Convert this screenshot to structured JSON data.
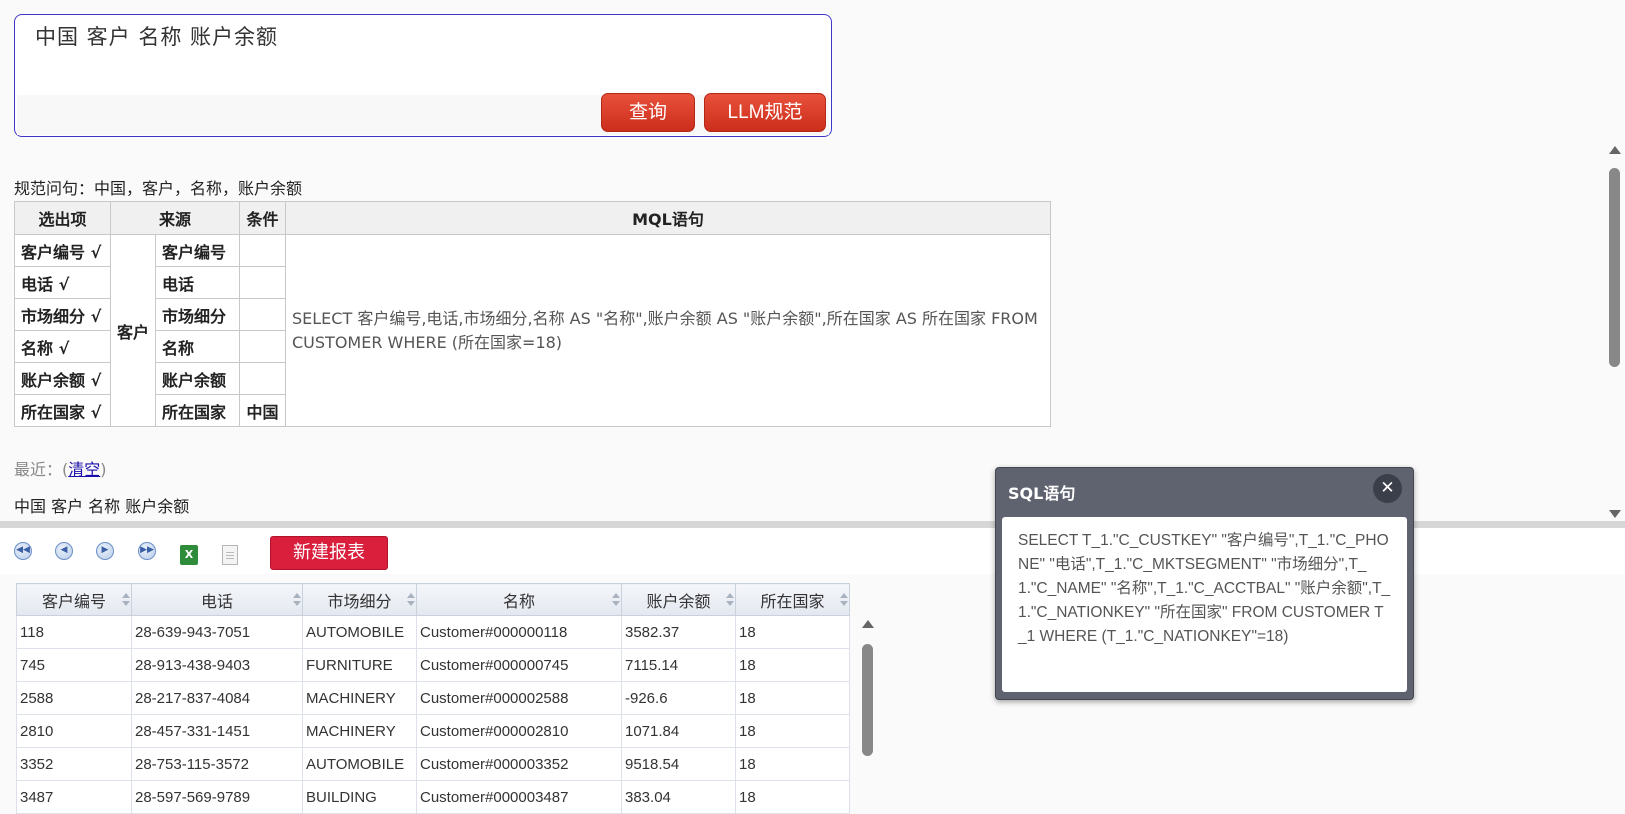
{
  "query": {
    "text": "中国  客户  名称  账户余额",
    "query_button": "查询",
    "llm_button": "LLM规范"
  },
  "normalized": {
    "label": "规范问句：",
    "text": "中国，客户，名称，账户余额"
  },
  "mql_table": {
    "headers": [
      "选出项",
      "来源",
      "条件",
      "MQL语句"
    ],
    "source_entity": "客户",
    "rows": [
      {
        "select": "客户编号 √",
        "field": "客户编号",
        "cond": ""
      },
      {
        "select": "电话 √",
        "field": "电话",
        "cond": ""
      },
      {
        "select": "市场细分 √",
        "field": "市场细分",
        "cond": ""
      },
      {
        "select": "名称 √",
        "field": "名称",
        "cond": ""
      },
      {
        "select": "账户余额 √",
        "field": "账户余额",
        "cond": ""
      },
      {
        "select": "所在国家 √",
        "field": "所在国家",
        "cond": "中国"
      }
    ],
    "mql": "SELECT 客户编号,电话,市场细分,名称 AS \"名称\",账户余额 AS \"账户余额\",所在国家 AS 所在国家 FROM CUSTOMER WHERE (所在国家=18)"
  },
  "recent": {
    "label": "最近：(",
    "clear_link": "清空",
    "close_paren": ")",
    "history_item": "中国 客户 名称 账户余额"
  },
  "toolbar": {
    "icons": [
      "first-page-icon",
      "prev-page-icon",
      "next-page-icon",
      "last-page-icon",
      "excel-export-icon",
      "document-icon"
    ],
    "excel_glyph": "X",
    "new_report_button": "新建报表"
  },
  "grid": {
    "columns": [
      "客户编号",
      "电话",
      "市场细分",
      "名称",
      "账户余额",
      "所在国家"
    ],
    "rows": [
      [
        "118",
        "28-639-943-7051",
        "AUTOMOBILE",
        "Customer#000000118",
        "3582.37",
        "18"
      ],
      [
        "745",
        "28-913-438-9403",
        "FURNITURE",
        "Customer#000000745",
        "7115.14",
        "18"
      ],
      [
        "2588",
        "28-217-837-4084",
        "MACHINERY",
        "Customer#000002588",
        "-926.6",
        "18"
      ],
      [
        "2810",
        "28-457-331-1451",
        "MACHINERY",
        "Customer#000002810",
        "1071.84",
        "18"
      ],
      [
        "3352",
        "28-753-115-3572",
        "AUTOMOBILE",
        "Customer#000003352",
        "9518.54",
        "18"
      ],
      [
        "3487",
        "28-597-569-9789",
        "BUILDING",
        "Customer#000003487",
        "383.04",
        "18"
      ]
    ]
  },
  "sql_dialog": {
    "title": "SQL语句",
    "close_glyph": "✕",
    "sql": "SELECT T_1.\"C_CUSTKEY\" \"客户编号\",T_1.\"C_PHONE\" \"电话\",T_1.\"C_MKTSEGMENT\" \"市场细分\",T_1.\"C_NAME\" \"名称\",T_1.\"C_ACCTBAL\" \"账户余额\",T_1.\"C_NATIONKEY\" \"所在国家\" FROM CUSTOMER T_1 WHERE (T_1.\"C_NATIONKEY\"=18)"
  }
}
